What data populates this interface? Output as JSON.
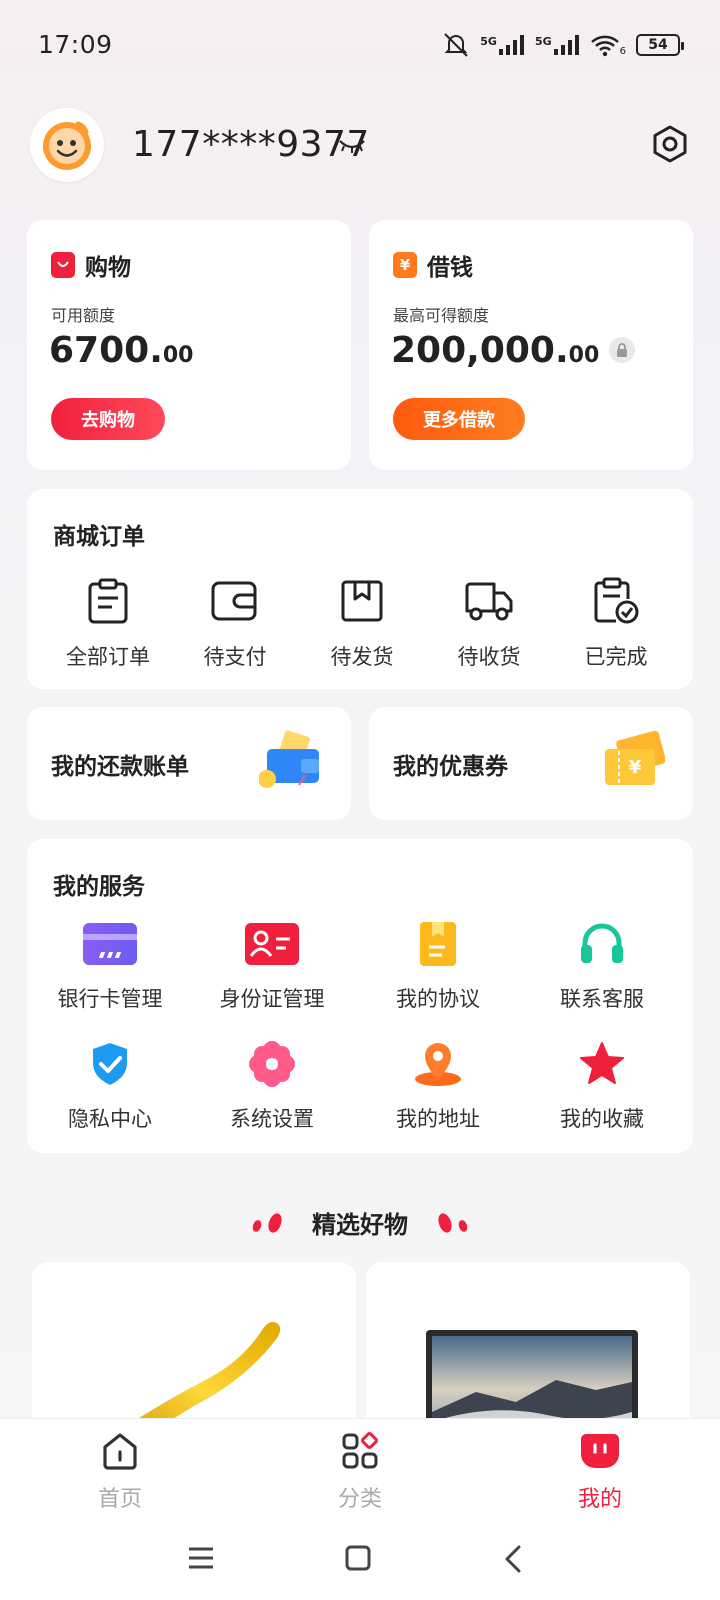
{
  "status_bar": {
    "time": "17:09",
    "signal1_label": "5G",
    "signal2_label": "5G",
    "wifi_sub": "6",
    "battery": "54"
  },
  "profile": {
    "phone": "177****9377",
    "avatar_icon": "smiley-avatar-icon",
    "eye_icon": "eye-closed-icon",
    "settings_icon": "gear-hexagon-icon"
  },
  "shopping": {
    "title": "购物",
    "label": "可用额度",
    "amount_int": "6700.",
    "amount_dec": "00",
    "button": "去购物",
    "accent": "#f0203d"
  },
  "borrow": {
    "title": "借钱",
    "icon_glyph": "¥",
    "label": "最高可得额度",
    "amount_int": "200,000.",
    "amount_dec": "00",
    "button": "更多借款",
    "accent": "#ff6a10"
  },
  "orders": {
    "title": "商城订单",
    "items": [
      {
        "label": "全部订单",
        "icon": "clipboard-list-icon"
      },
      {
        "label": "待支付",
        "icon": "wallet-icon"
      },
      {
        "label": "待发货",
        "icon": "box-icon"
      },
      {
        "label": "待收货",
        "icon": "truck-icon"
      },
      {
        "label": "已完成",
        "icon": "clipboard-check-icon"
      }
    ]
  },
  "bills": {
    "title": "我的还款账单"
  },
  "coupons": {
    "title": "我的优惠券",
    "icon_glyph": "¥"
  },
  "services": {
    "title": "我的服务",
    "items": [
      {
        "label": "银行卡管理",
        "icon": "bank-card-icon"
      },
      {
        "label": "身份证管理",
        "icon": "id-card-icon"
      },
      {
        "label": "我的协议",
        "icon": "agreement-icon"
      },
      {
        "label": "联系客服",
        "icon": "headset-icon"
      },
      {
        "label": "隐私中心",
        "icon": "shield-check-icon"
      },
      {
        "label": "系统设置",
        "icon": "flower-gear-icon"
      },
      {
        "label": "我的地址",
        "icon": "location-pin-icon"
      },
      {
        "label": "我的收藏",
        "icon": "star-icon"
      }
    ]
  },
  "featured": {
    "title": "精选好物"
  },
  "bottom_nav": {
    "items": [
      {
        "label": "首页",
        "icon": "home-icon",
        "active": false
      },
      {
        "label": "分类",
        "icon": "category-icon",
        "active": false
      },
      {
        "label": "我的",
        "icon": "profile-face-icon",
        "active": true
      }
    ],
    "active_color": "#f0203d",
    "inactive_color": "#aaaaaa"
  }
}
